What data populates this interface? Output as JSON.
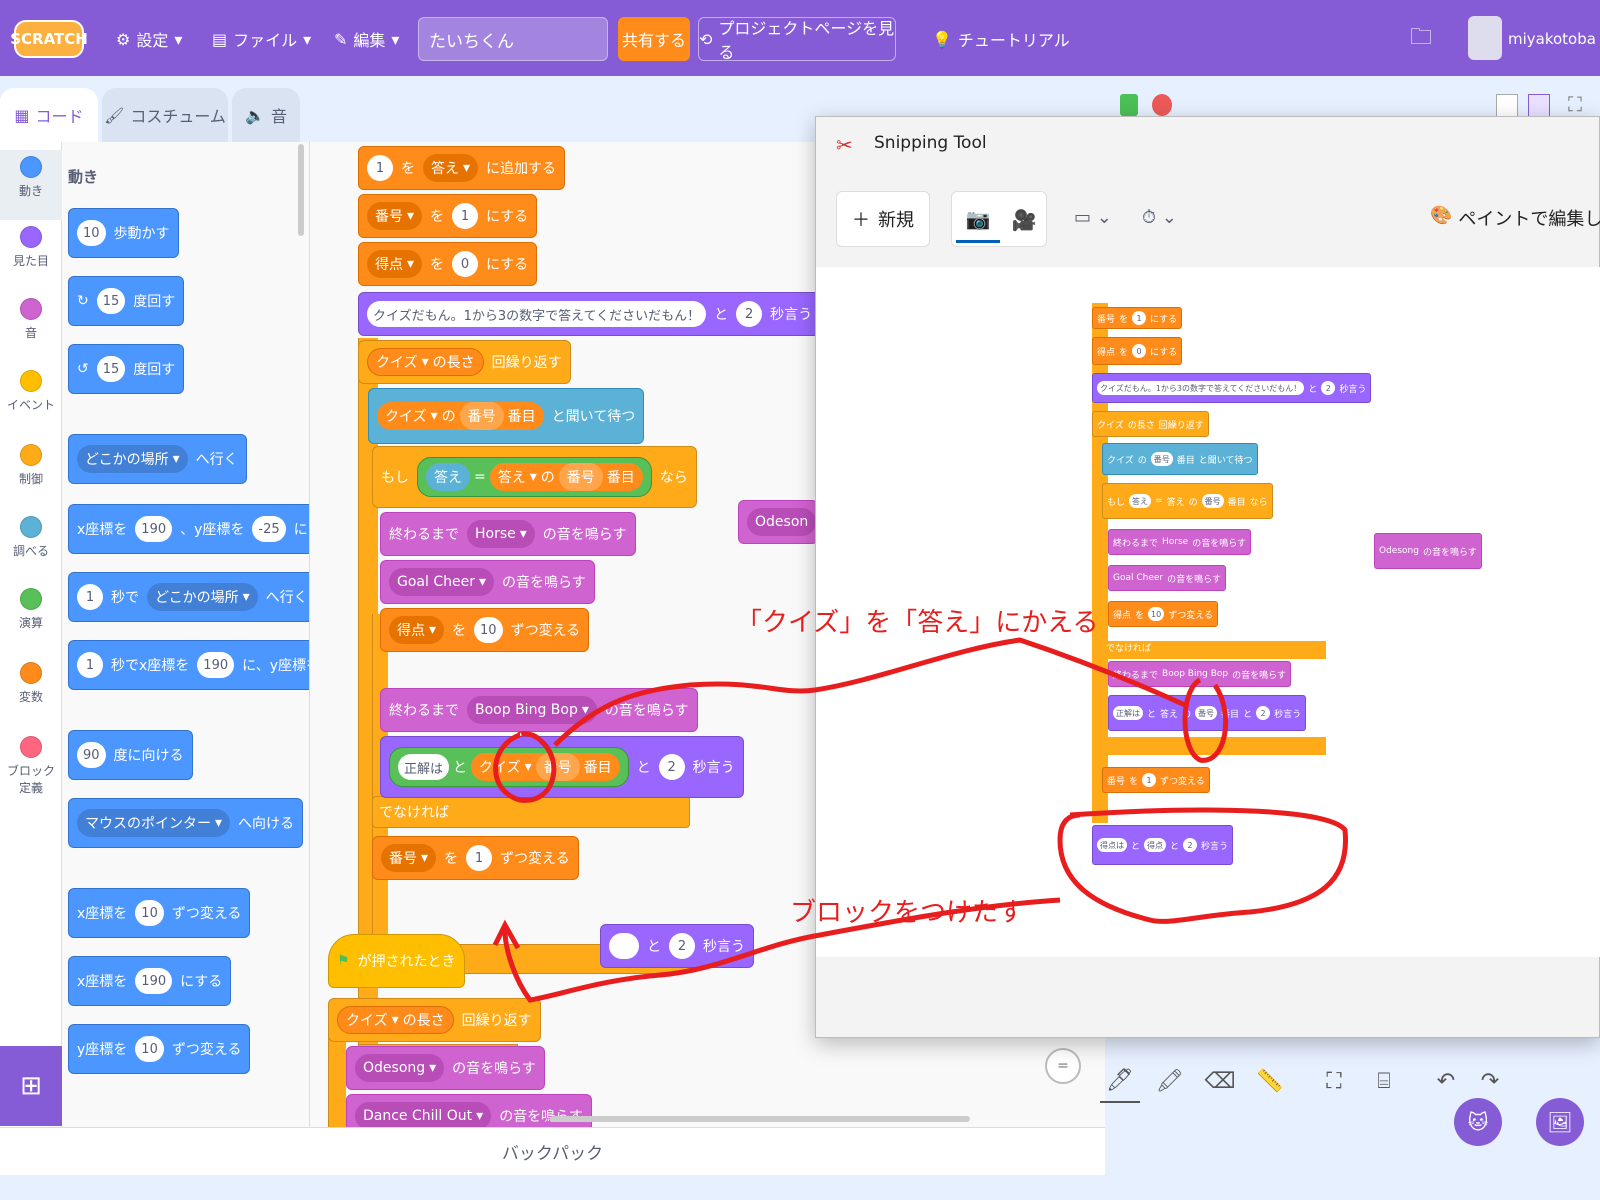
{
  "menubar": {
    "logo": "SCRATCH",
    "settings": "設定",
    "file": "ファイル",
    "edit": "編集",
    "project_title": "たいちくん",
    "share": "共有する",
    "project_page": "プロジェクトページを見る",
    "tutorial": "チュートリアル",
    "username": "miyakotoba"
  },
  "tabs": {
    "code": "コード",
    "costume": "コスチューム",
    "sound": "音"
  },
  "categories": [
    {
      "label": "動き",
      "color": "#4c97ff"
    },
    {
      "label": "見た目",
      "color": "#9966ff"
    },
    {
      "label": "音",
      "color": "#cf63cf"
    },
    {
      "label": "イベント",
      "color": "#ffbf00"
    },
    {
      "label": "制御",
      "color": "#ffab19"
    },
    {
      "label": "調べる",
      "color": "#5cb1d6"
    },
    {
      "label": "演算",
      "color": "#59c059"
    },
    {
      "label": "変数",
      "color": "#ff8c1a"
    },
    {
      "label": "ブロック定義",
      "color": "#ff6680"
    }
  ],
  "palette": {
    "heading": "動き",
    "b1": {
      "n": "10",
      "t": "歩動かす"
    },
    "b2": {
      "n": "15",
      "t": "度回す"
    },
    "b3": {
      "n": "15",
      "t": "度回す"
    },
    "b4": {
      "dd": "どこかの場所",
      "t": "へ行く"
    },
    "b5": {
      "a": "x座標を",
      "n1": "190",
      "b": "、y座標を",
      "n2": "-25",
      "c": "にする"
    },
    "b6": {
      "n": "1",
      "a": "秒で",
      "dd": "どこかの場所",
      "t": "へ行く"
    },
    "b7": {
      "n": "1",
      "a": "秒でx座標を",
      "n2": "190",
      "b": "に、y座標を"
    },
    "b8": {
      "n": "90",
      "t": "度に向ける"
    },
    "b9": {
      "dd": "マウスのポインター",
      "t": "へ向ける"
    },
    "b10": {
      "a": "x座標を",
      "n": "10",
      "t": "ずつ変える"
    },
    "b11": {
      "a": "x座標を",
      "n": "190",
      "t": "にする"
    },
    "b12": {
      "a": "y座標を",
      "n": "10",
      "t": "ずつ変える"
    }
  },
  "script": {
    "s1": {
      "n": "1",
      "a": "を",
      "dd": "答え",
      "t": "に追加する"
    },
    "s2": {
      "dd": "番号",
      "a": "を",
      "n": "1",
      "t": "にする"
    },
    "s3": {
      "dd": "得点",
      "a": "を",
      "n": "0",
      "t": "にする"
    },
    "s4": {
      "text": "クイズだもん。1から3の数字で答えてくださいだもん！",
      "a": "と",
      "n": "2",
      "t": "秒言う"
    },
    "s5": {
      "dd": "クイズ",
      "a": "の長さ",
      "t": "回繰り返す"
    },
    "s6": {
      "dd": "クイズ",
      "a": "の",
      "v": "番号",
      "b": "番目",
      "t": "と聞いて待つ"
    },
    "s7": {
      "if": "もし",
      "ans": "答え",
      "eq": "=",
      "dd": "答え",
      "a": "の",
      "v": "番号",
      "b": "番目",
      "then": "なら"
    },
    "s8": {
      "a": "終わるまで",
      "dd": "Horse",
      "t": "の音を鳴らす"
    },
    "s9": {
      "dd": "Goal Cheer",
      "t": "の音を鳴らす"
    },
    "s10": {
      "dd": "得点",
      "a": "を",
      "n": "10",
      "t": "ずつ変える"
    },
    "s11": "でなければ",
    "s12": {
      "a": "終わるまで",
      "dd": "Boop Bing Bop",
      "t": "の音を鳴らす"
    },
    "s13": {
      "c": "正解は",
      "a": "と",
      "dd": "クイズ",
      "v": "番号",
      "b": "番目",
      "x": "と",
      "n": "2",
      "t": "秒言う"
    },
    "s14": {
      "dd": "番号",
      "a": "を",
      "n": "1",
      "t": "ずつ変える"
    },
    "loose": {
      "a": "と",
      "n": "2",
      "t": "秒言う"
    },
    "flag": "が押されたとき",
    "f2": {
      "dd": "クイズ",
      "a": "の長さ",
      "t": "回繰り返す"
    },
    "f3": {
      "dd": "Odesong",
      "t": "の音を鳴らす"
    },
    "f4": {
      "dd": "Dance Chill Out",
      "t": "の音を鳴らす"
    },
    "odes": "Odeson"
  },
  "backpack": "バックパック",
  "snip": {
    "title": "Snipping Tool",
    "new": "新規",
    "paint": "ペイントで編集します",
    "m1": {
      "dd": "番号",
      "a": "を",
      "n": "1",
      "t": "にする"
    },
    "m2": {
      "dd": "得点",
      "a": "を",
      "n": "0",
      "t": "にする"
    },
    "m3": {
      "text": "クイズだもん。1から3の数字で答えてくださいだもん！",
      "a": "と",
      "n": "2",
      "t": "秒言う"
    },
    "m4": {
      "dd": "クイズ",
      "a": "の長さ",
      "t": "回繰り返す"
    },
    "m5": {
      "dd": "クイズ",
      "a": "の",
      "v": "番号",
      "b": "番目",
      "t": "と聞いて待つ"
    },
    "m6": {
      "if": "もし",
      "ans": "答え",
      "eq": "=",
      "dd": "答え",
      "a": "の",
      "v": "番号",
      "b": "番目",
      "then": "なら"
    },
    "m7": {
      "a": "終わるまで",
      "dd": "Horse",
      "t": "の音を鳴らす"
    },
    "m8": {
      "dd": "Goal Cheer",
      "t": "の音を鳴らす"
    },
    "m9": {
      "dd": "得点",
      "a": "を",
      "n": "10",
      "t": "ずつ変える"
    },
    "m10": "でなければ",
    "m11": {
      "a": "終わるまで",
      "dd": "Boop Bing Bop",
      "t": "の音を鳴らす"
    },
    "m12": {
      "c": "正解は",
      "a": "と",
      "dd": "答え",
      "x": "の",
      "v": "番号",
      "b": "番目",
      "y": "と",
      "n": "2",
      "t": "秒言う"
    },
    "m13": {
      "dd": "番号",
      "a": "を",
      "n": "1",
      "t": "ずつ変える"
    },
    "m14": {
      "c": "得点は",
      "a": "と",
      "v": "得点",
      "x": "と",
      "n": "2",
      "t": "秒言う"
    },
    "m15": {
      "dd": "Odesong",
      "t": "の音を鳴らす"
    }
  },
  "annotations": {
    "a1": "「クイズ」を「答え」にかえる",
    "a2": "ブロックをつけたす"
  }
}
